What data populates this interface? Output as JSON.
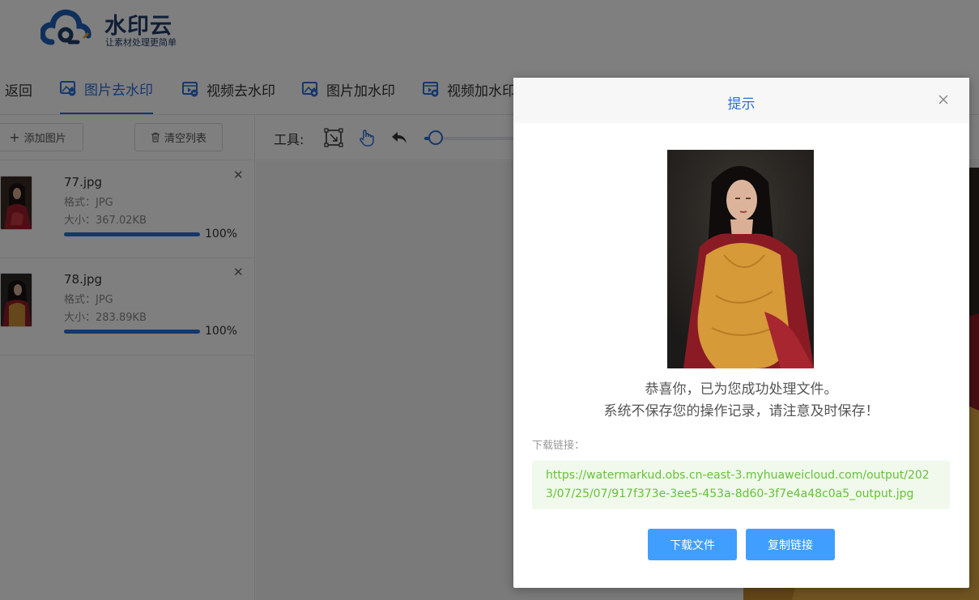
{
  "app": {
    "brand_name": "水印云",
    "brand_slogan": "让素材处理更简单"
  },
  "tabs": [
    {
      "label": "返回",
      "icon": "back",
      "active": false
    },
    {
      "label": "图片去水印",
      "icon": "image-icon",
      "active": true
    },
    {
      "label": "视频去水印",
      "icon": "video-icon",
      "active": false
    },
    {
      "label": "图片加水印",
      "icon": "image-add-icon",
      "active": false
    },
    {
      "label": "视频加水印",
      "icon": "video-add-icon",
      "active": false
    }
  ],
  "left_panel": {
    "add_button": "添加图片",
    "clear_button": "清空列表",
    "files": [
      {
        "name": "77.jpg",
        "format": "格式：JPG",
        "size": "大小：367.02KB",
        "progress": 100,
        "progress_label": "100%"
      },
      {
        "name": "78.jpg",
        "format": "格式：JPG",
        "size": "大小：283.89KB",
        "progress": 100,
        "progress_label": "100%"
      }
    ]
  },
  "toolbar": {
    "label": "工具:",
    "tools": [
      "select-region-icon",
      "hand-icon",
      "undo-icon"
    ],
    "brush_size": 10
  },
  "dialog": {
    "title": "提示",
    "message_line1": "恭喜你，已为您成功处理文件。",
    "message_line2": "系统不保存您的操作记录，请注意及时保存！",
    "link_label": "下载链接：",
    "link_url": "https://watermarkud.obs.cn-east-3.myhuaweicloud.com/output/2023/07/25/07/917f373e-3ee5-453a-8d60-3f7e4a48c0a5_output.jpg",
    "download_button": "下载文件",
    "copy_button": "复制链接"
  },
  "colors": {
    "accent": "#2b6ed8",
    "button_primary": "#409eff",
    "link_text": "#67c23a",
    "link_bg": "#f0f9eb",
    "brand_dark": "#1f3c6b"
  }
}
